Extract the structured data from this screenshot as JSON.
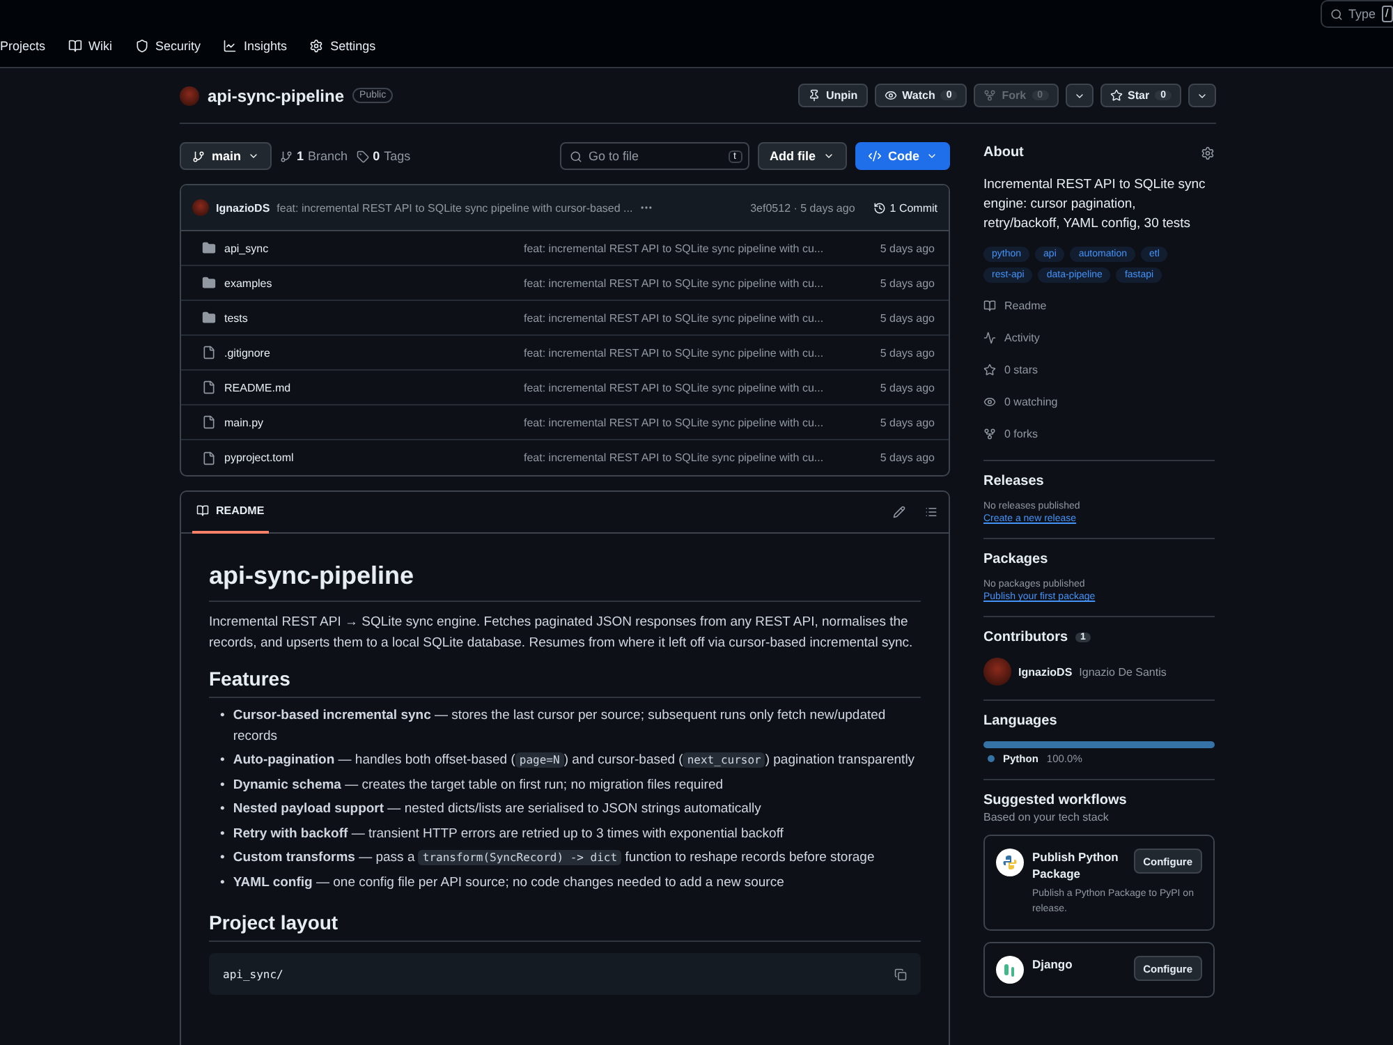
{
  "top_search": {
    "placeholder": "Type",
    "shortcut": "/"
  },
  "nav": [
    {
      "label": "Projects"
    },
    {
      "label": "Wiki"
    },
    {
      "label": "Security"
    },
    {
      "label": "Insights"
    },
    {
      "label": "Settings"
    }
  ],
  "repo": {
    "name": "api-sync-pipeline",
    "visibility": "Public"
  },
  "actions": [
    {
      "label": "Unpin",
      "disabled": false,
      "dropdown": false
    },
    {
      "label": "Watch",
      "count": "0",
      "disabled": false,
      "dropdown": false
    },
    {
      "label": "Fork",
      "count": "0",
      "disabled": true,
      "dropdown": true
    },
    {
      "label": "Star",
      "count": "0",
      "disabled": false,
      "dropdown": true
    }
  ],
  "branch": {
    "name": "main",
    "branch_count": "1",
    "branch_label": "Branch",
    "tag_count": "0",
    "tag_label": "Tags"
  },
  "go_to_file": {
    "placeholder": "Go to file",
    "shortcut": "t"
  },
  "add_file": "Add file",
  "code_button": "Code",
  "commit": {
    "author": "IgnazioDS",
    "message": "feat: incremental REST API to SQLite sync pipeline with cursor-based ...",
    "hash_time": "3ef0512 · 5 days ago",
    "commits": "1 Commit"
  },
  "files": [
    {
      "name": "api_sync",
      "kind": "folder",
      "message": "feat: incremental REST API to SQLite sync pipeline with cu...",
      "time": "5 days ago"
    },
    {
      "name": "examples",
      "kind": "folder",
      "message": "feat: incremental REST API to SQLite sync pipeline with cu...",
      "time": "5 days ago"
    },
    {
      "name": "tests",
      "kind": "folder",
      "message": "feat: incremental REST API to SQLite sync pipeline with cu...",
      "time": "5 days ago"
    },
    {
      "name": ".gitignore",
      "kind": "file",
      "message": "feat: incremental REST API to SQLite sync pipeline with cu...",
      "time": "5 days ago"
    },
    {
      "name": "README.md",
      "kind": "file",
      "message": "feat: incremental REST API to SQLite sync pipeline with cu...",
      "time": "5 days ago"
    },
    {
      "name": "main.py",
      "kind": "file",
      "message": "feat: incremental REST API to SQLite sync pipeline with cu...",
      "time": "5 days ago"
    },
    {
      "name": "pyproject.toml",
      "kind": "file",
      "message": "feat: incremental REST API to SQLite sync pipeline with cu...",
      "time": "5 days ago"
    }
  ],
  "readme": {
    "tab": "README",
    "title": "api-sync-pipeline",
    "intro": "Incremental REST API → SQLite sync engine. Fetches paginated JSON responses from any REST API, normalises the records, and upserts them to a local SQLite database. Resumes from where it left off via cursor-based incremental sync.",
    "features_heading": "Features",
    "bullet": "•",
    "features": [
      [
        {
          "kind": "bold",
          "text": "Cursor-based incremental sync"
        },
        {
          "kind": "plain",
          "text": " — stores the last cursor per source; subsequent runs only fetch new/updated records"
        }
      ],
      [
        {
          "kind": "bold",
          "text": "Auto-pagination"
        },
        {
          "kind": "plain",
          "text": " — handles both offset-based ("
        },
        {
          "kind": "code",
          "text": "page=N"
        },
        {
          "kind": "plain",
          "text": ") and cursor-based ("
        },
        {
          "kind": "code",
          "text": "next_cursor"
        },
        {
          "kind": "plain",
          "text": ") pagination transparently"
        }
      ],
      [
        {
          "kind": "bold",
          "text": "Dynamic schema"
        },
        {
          "kind": "plain",
          "text": " — creates the target table on first run; no migration files required"
        }
      ],
      [
        {
          "kind": "bold",
          "text": "Nested payload support"
        },
        {
          "kind": "plain",
          "text": " — nested dicts/lists are serialised to JSON strings automatically"
        }
      ],
      [
        {
          "kind": "bold",
          "text": "Retry with backoff"
        },
        {
          "kind": "plain",
          "text": " — transient HTTP errors are retried up to 3 times with exponential backoff"
        }
      ],
      [
        {
          "kind": "bold",
          "text": "Custom transforms"
        },
        {
          "kind": "plain",
          "text": " — pass a "
        },
        {
          "kind": "code",
          "text": "transform(SyncRecord) -> dict"
        },
        {
          "kind": "plain",
          "text": " function to reshape records before storage"
        }
      ],
      [
        {
          "kind": "bold",
          "text": "YAML config"
        },
        {
          "kind": "plain",
          "text": " — one config file per API source; no code changes needed to add a new source"
        }
      ]
    ],
    "layout_heading": "Project layout",
    "code_first_line": "api_sync/"
  },
  "about": {
    "heading": "About",
    "description": "Incremental REST API to SQLite sync engine: cursor pagination, retry/backoff, YAML config, 30 tests",
    "topics": [
      "python",
      "api",
      "automation",
      "etl",
      "rest-api",
      "data-pipeline",
      "fastapi"
    ],
    "stats": [
      "Readme",
      "Activity",
      "0 stars",
      "0 watching",
      "0 forks"
    ]
  },
  "releases": {
    "heading": "Releases",
    "note": "No releases published",
    "link": "Create a new release"
  },
  "packages": {
    "heading": "Packages",
    "note": "No packages published",
    "link": "Publish your first package"
  },
  "contributors": {
    "heading": "Contributors",
    "count": "1",
    "people": [
      {
        "login": "IgnazioDS",
        "name": "Ignazio De Santis"
      }
    ]
  },
  "languages": {
    "heading": "Languages",
    "items": [
      {
        "name": "Python",
        "percent": "100.0%",
        "level": 1.0,
        "color": "#3572a5"
      }
    ]
  },
  "workflows": {
    "heading": "Suggested workflows",
    "subtitle": "Based on your tech stack",
    "items": [
      {
        "kind": "python",
        "title": "Publish Python Package",
        "description": "Publish a Python Package to PyPI on release.",
        "button": "Configure"
      },
      {
        "kind": "django",
        "title": "Django",
        "button": "Configure"
      }
    ]
  }
}
